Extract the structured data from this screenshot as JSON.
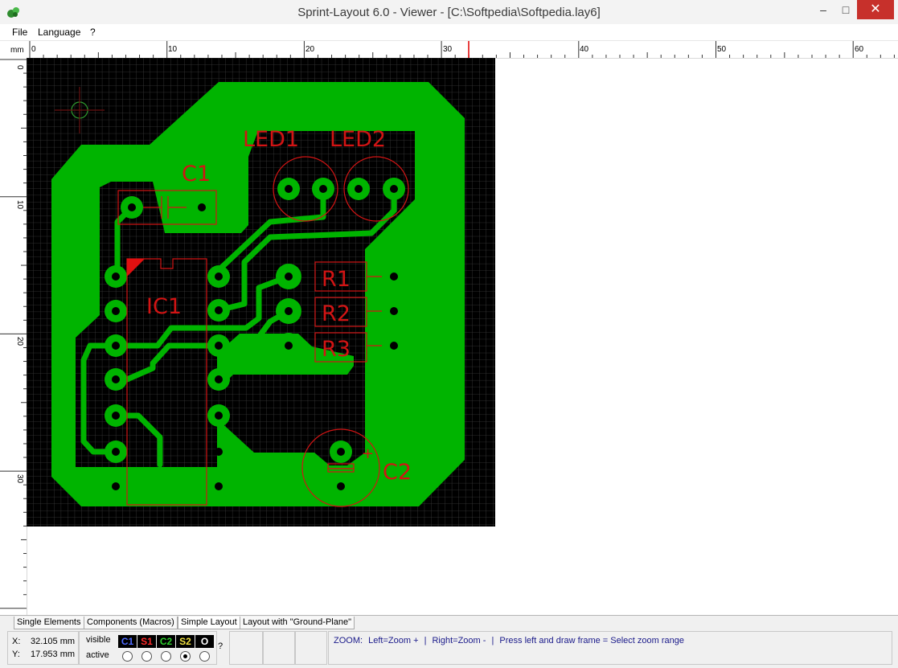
{
  "window": {
    "title": "Sprint-Layout 6.0 - Viewer - [C:\\Softpedia\\Softpedia.lay6]",
    "minimize": "–",
    "maximize": "□",
    "close": "✕"
  },
  "menu": {
    "items": [
      "File",
      "Language",
      "?"
    ]
  },
  "ruler": {
    "unit": "mm",
    "top_ticks": [
      "0",
      "10",
      "20",
      "30",
      "40",
      "50",
      "60"
    ],
    "left_ticks": [
      "0",
      "10",
      "20",
      "30"
    ]
  },
  "board": {
    "labels": {
      "led1": "LED1",
      "led2": "LED2",
      "c1": "C1",
      "ic1": "IC1",
      "r1": "R1",
      "r2": "R2",
      "r3": "R3",
      "c2": "C2",
      "c2_plus": "+"
    },
    "colors": {
      "background": "#000000",
      "grid": "#3c3c3c",
      "copper": "#00b400",
      "silk": "#d21414",
      "drill": "#000000"
    }
  },
  "tabs": [
    {
      "label": "Single Elements"
    },
    {
      "label": "Components (Macros)"
    },
    {
      "label": "Simple Layout"
    },
    {
      "label": "Layout with \"Ground-Plane\""
    }
  ],
  "status": {
    "x_label": "X:",
    "x_value": "32.105 mm",
    "y_label": "Y:",
    "y_value": "17.953 mm",
    "visible_label": "visible",
    "active_label": "active",
    "help": "?",
    "layers": [
      {
        "name": "C1",
        "color": "#4f6bff"
      },
      {
        "name": "S1",
        "color": "#ff2a2a"
      },
      {
        "name": "C2",
        "color": "#2dd02d"
      },
      {
        "name": "S2",
        "color": "#f0e040"
      },
      {
        "name": "O",
        "color": "#ffffff"
      }
    ],
    "active_layer_index": 3,
    "zoom_hint": [
      "ZOOM:",
      "Left=Zoom +",
      "|",
      "Right=Zoom -",
      "|",
      "Press left and draw frame = Select zoom range"
    ]
  }
}
